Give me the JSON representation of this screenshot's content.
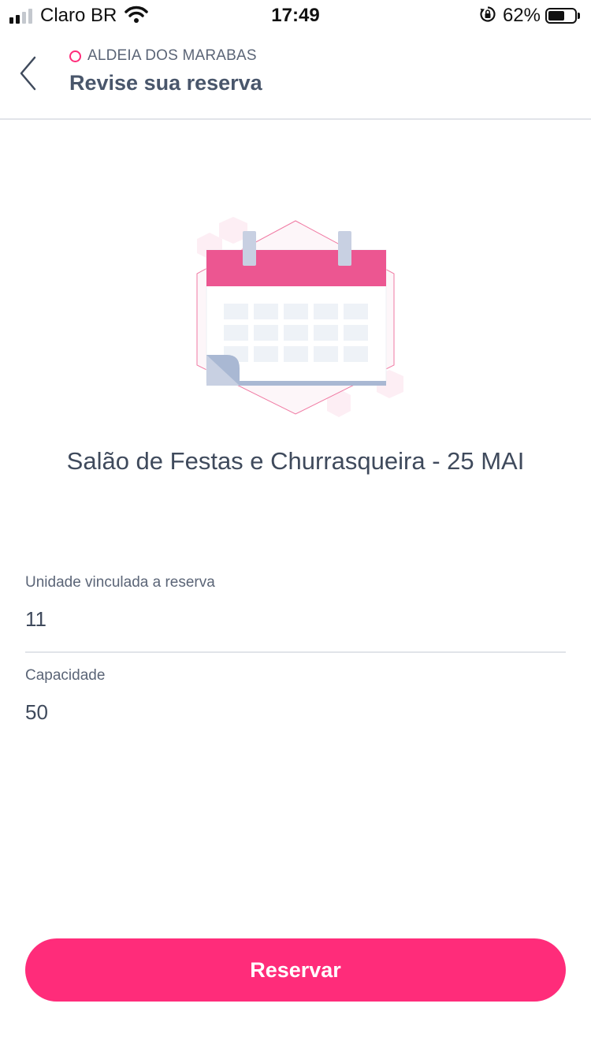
{
  "status_bar": {
    "carrier": "Claro BR",
    "time": "17:49",
    "battery_percent": "62%",
    "battery_level": 0.62,
    "signal_bars_active": 2,
    "signal_bars_total": 4,
    "icons": [
      "signal-icon",
      "wifi-icon",
      "orientation-lock-icon",
      "battery-icon"
    ]
  },
  "header": {
    "back_icon": "chevron-left-icon",
    "condominium": "ALDEIA DOS MARABAS",
    "title": "Revise sua reserva"
  },
  "illustration": {
    "icon": "calendar-icon"
  },
  "reservation": {
    "title": "Salão de Festas e Churrasqueira - 25 MAI"
  },
  "fields": [
    {
      "label": "Unidade vinculada a reserva",
      "value": "11"
    },
    {
      "label": "Capacidade",
      "value": "50"
    }
  ],
  "actions": {
    "reserve_label": "Reservar"
  },
  "colors": {
    "accent": "#ff2c7a",
    "calendar_header": "#ec5691",
    "text_primary": "#3f4a5c",
    "text_secondary": "#5b6577",
    "divider": "#e1e4e9"
  }
}
